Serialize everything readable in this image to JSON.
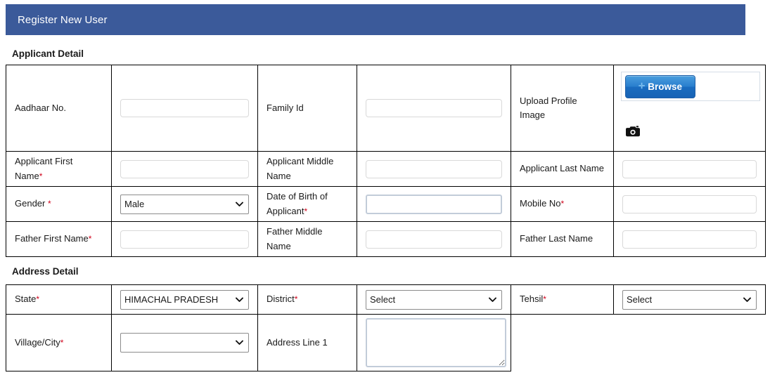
{
  "header": {
    "title": "Register New User",
    "bg_color": "#3b5a9a",
    "text_color": "#ffffff"
  },
  "sections": {
    "applicant": {
      "heading": "Applicant Detail"
    },
    "address": {
      "heading": "Address Detail"
    }
  },
  "required_marker": "*",
  "required_color": "#d0021b",
  "applicant_rows": [
    {
      "cells": [
        {
          "label": "Aadhaar No.",
          "required": false
        },
        {
          "type": "text",
          "value": ""
        },
        {
          "label": "Family Id",
          "required": false
        },
        {
          "type": "text",
          "value": ""
        },
        {
          "label": "Upload Profile Image",
          "required": false
        },
        {
          "type": "upload"
        }
      ]
    },
    {
      "cells": [
        {
          "label": "Applicant First Name",
          "required": true
        },
        {
          "type": "text",
          "value": ""
        },
        {
          "label": "Applicant Middle Name",
          "required": false
        },
        {
          "type": "text",
          "value": ""
        },
        {
          "label": "Applicant Last Name",
          "required": false
        },
        {
          "type": "text",
          "value": ""
        }
      ]
    },
    {
      "cells": [
        {
          "label": "Gender ",
          "required": true
        },
        {
          "type": "select",
          "value": "Male"
        },
        {
          "label": "Date of Birth of Applicant",
          "required": true
        },
        {
          "type": "date",
          "value": ""
        },
        {
          "label": "Mobile No",
          "required": true
        },
        {
          "type": "text",
          "value": ""
        }
      ]
    },
    {
      "cells": [
        {
          "label": "Father First Name",
          "required": true
        },
        {
          "type": "text",
          "value": ""
        },
        {
          "label": "Father Middle Name",
          "required": false
        },
        {
          "type": "text",
          "value": ""
        },
        {
          "label": "Father Last Name",
          "required": false
        },
        {
          "type": "text",
          "value": ""
        }
      ]
    }
  ],
  "address_rows": [
    {
      "cells": [
        {
          "label": "State",
          "required": true
        },
        {
          "type": "select",
          "value": "HIMACHAL PRADESH"
        },
        {
          "label": "District",
          "required": true
        },
        {
          "type": "select",
          "value": "Select"
        },
        {
          "label": "Tehsil",
          "required": true
        },
        {
          "type": "select",
          "value": "Select"
        }
      ]
    },
    {
      "cells": [
        {
          "label": "Village/City",
          "required": true
        },
        {
          "type": "select",
          "value": ""
        },
        {
          "label": "Address Line 1",
          "required": false
        },
        {
          "type": "textarea",
          "value": ""
        }
      ]
    }
  ],
  "labels": {
    "aadhaar_no": "Aadhaar No.",
    "family_id": "Family Id",
    "upload_profile_image": "Upload Profile Image",
    "applicant_first_name": "Applicant First Name",
    "applicant_middle_name": "Applicant Middle Name",
    "applicant_last_name": "Applicant Last Name",
    "gender": "Gender ",
    "dob": "Date of Birth of Applicant",
    "mobile_no": "Mobile No",
    "father_first_name": "Father First Name",
    "father_middle_name": "Father Middle Name",
    "father_last_name": "Father Last Name",
    "state": "State",
    "district": "District",
    "tehsil": "Tehsil",
    "village_city": "Village/City",
    "address_line_1": "Address Line 1"
  },
  "values": {
    "aadhaar_no": "",
    "family_id": "",
    "applicant_first_name": "",
    "applicant_middle_name": "",
    "applicant_last_name": "",
    "gender": "Male",
    "dob": "",
    "mobile_no": "",
    "father_first_name": "",
    "father_middle_name": "",
    "father_last_name": "",
    "state": "HIMACHAL PRADESH",
    "district": "Select",
    "tehsil": "Select",
    "village_city": "",
    "address_line_1": ""
  },
  "upload": {
    "browse_label": "Browse",
    "plus_glyph": "✛",
    "camera_icon": "camera-icon",
    "button_color": "#2a7fce"
  }
}
